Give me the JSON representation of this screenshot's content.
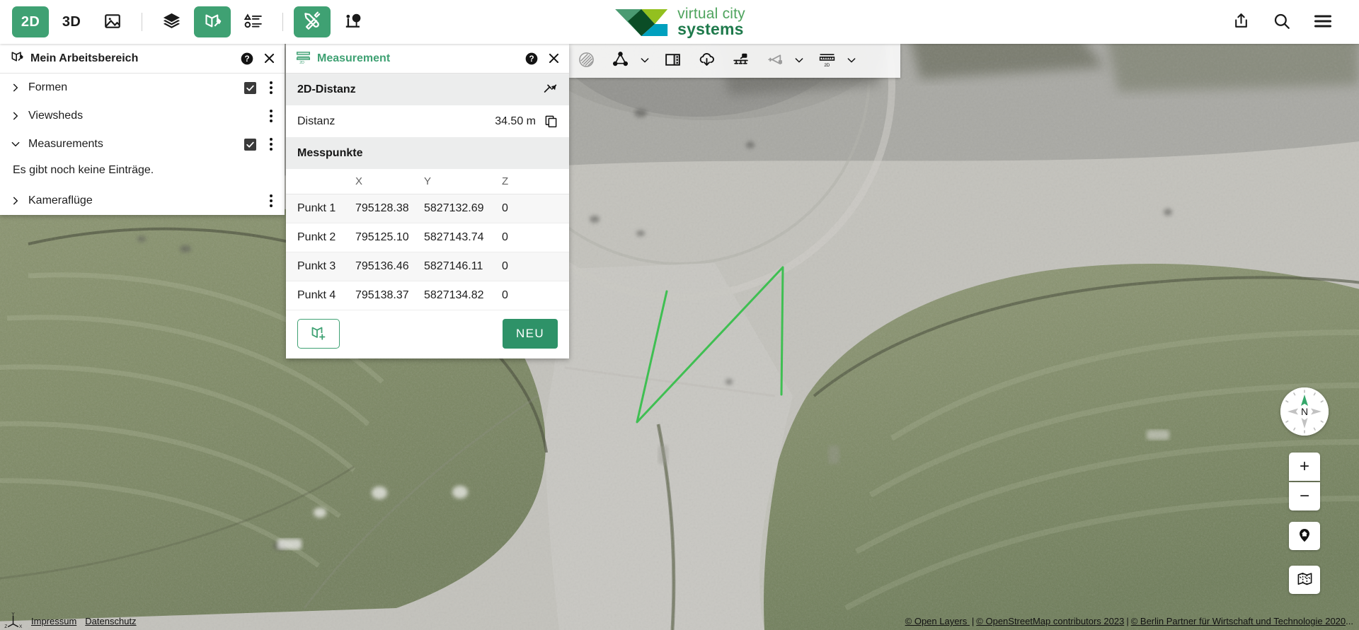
{
  "topbar": {
    "left_items": [
      {
        "name": "2d-mode-button",
        "label": "2D",
        "icon": "text-2d",
        "active": true
      },
      {
        "name": "3d-mode-button",
        "label": "3D",
        "icon": "text-3d",
        "active": false
      },
      {
        "name": "oblique-image-button",
        "label": "",
        "icon": "image-icon",
        "active": false
      },
      {
        "name": "separator-1",
        "label": "",
        "icon": "separator",
        "active": false
      },
      {
        "name": "layers-button",
        "label": "",
        "icon": "layers-icon",
        "active": false
      },
      {
        "name": "workspace-button",
        "label": "",
        "icon": "workspace-icon",
        "active": true
      },
      {
        "name": "legend-button",
        "label": "",
        "icon": "legend-icon",
        "active": false
      },
      {
        "name": "separator-2",
        "label": "",
        "icon": "separator",
        "active": false
      },
      {
        "name": "tools-button",
        "label": "",
        "icon": "tools-icon",
        "active": true
      },
      {
        "name": "planning-button",
        "label": "",
        "icon": "tree-person-icon",
        "active": false
      }
    ],
    "right_items": [
      {
        "name": "share-button",
        "icon": "share-icon"
      },
      {
        "name": "search-button",
        "icon": "search-icon"
      },
      {
        "name": "menu-button",
        "icon": "hamburger-icon"
      }
    ],
    "brand": {
      "line1": "virtual city",
      "line2": "systems"
    }
  },
  "workspace": {
    "title": "Mein Arbeitsbereich",
    "help_icon": "help-icon",
    "close_icon": "close-icon",
    "items": [
      {
        "label": "Formen",
        "expanded": false,
        "checkbox": false,
        "has_menu": true
      },
      {
        "label": "Viewsheds",
        "expanded": false,
        "checkbox": false,
        "has_menu": true
      },
      {
        "label": "Measurements",
        "expanded": true,
        "checkbox": true,
        "has_menu": true
      },
      {
        "label": "Kameraflüge",
        "expanded": false,
        "checkbox": false,
        "has_menu": true
      }
    ],
    "formen_checkbox": true,
    "empty_message": "Es gibt noch keine Einträge."
  },
  "measurement": {
    "title": "Measurement",
    "title_icon": "measure-2d-icon",
    "help_icon": "help-icon",
    "close_icon": "close-icon",
    "section_title": "2D-Distanz",
    "section_icon": "measure-path-icon",
    "distance_label": "Distanz",
    "distance_value": "34.50 m",
    "copy_icon": "copy-icon",
    "points_title": "Messpunkte",
    "columns": [
      "",
      "X",
      "Y",
      "Z"
    ],
    "rows": [
      {
        "name": "Punkt 1",
        "x": "795128.38",
        "y": "5827132.69",
        "z": "0"
      },
      {
        "name": "Punkt 2",
        "x": "795125.10",
        "y": "5827143.74",
        "z": "0"
      },
      {
        "name": "Punkt 3",
        "x": "795136.46",
        "y": "5827146.11",
        "z": "0"
      },
      {
        "name": "Punkt 4",
        "x": "795138.37",
        "y": "5827134.82",
        "z": "0"
      }
    ],
    "add_to_workspace_icon": "workspace-add-icon",
    "new_label": "NEU"
  },
  "map_toolbar": {
    "items": [
      {
        "name": "shadow-tool-button",
        "icon": "sphere-hatch-icon",
        "disabled": true,
        "caret": false
      },
      {
        "name": "create-shape-button",
        "icon": "polygon-points-icon",
        "disabled": false,
        "caret": true
      },
      {
        "name": "split-view-button",
        "icon": "split-view-icon",
        "disabled": false,
        "caret": false
      },
      {
        "name": "export-button",
        "icon": "cloud-download-icon",
        "disabled": false,
        "caret": false
      },
      {
        "name": "viewshed-button",
        "icon": "viewshed-icon",
        "disabled": false,
        "caret": false
      },
      {
        "name": "flight-button",
        "icon": "camera-flight-icon",
        "disabled": true,
        "caret": true
      },
      {
        "name": "measurement-tool-button",
        "icon": "measure-2d-icon",
        "disabled": false,
        "caret": true
      }
    ]
  },
  "map_controls": {
    "compass_label": "N",
    "zoom_in_label": "+",
    "zoom_out_label": "−",
    "home_icon": "home-pin-icon",
    "overview_icon": "overview-map-icon"
  },
  "footer": {
    "axis_icon": "axis-orientation-icon",
    "axis_labels": {
      "y": "Y",
      "z": "Z",
      "x": "X"
    },
    "links": [
      {
        "name": "impressum-link",
        "label": "Impressum"
      },
      {
        "name": "datenschutz-link",
        "label": "Datenschutz"
      }
    ],
    "attribution": [
      {
        "name": "open-layers-link",
        "label": "© Open Layers "
      },
      {
        "name": "osm-link",
        "label": "© OpenStreetMap contributors 2023"
      },
      {
        "name": "berlin-partner-link",
        "label": "© Berlin Partner für Wirtschaft und Technologie 2020"
      }
    ],
    "attribution_sep": "|",
    "attribution_ellipsis": "..."
  },
  "colors": {
    "accent_green": "#3FA173",
    "primary_button": "#2E9268",
    "measurement_line": "#3FBF52",
    "brand_light_green": "#4FA45E",
    "brand_dark_green": "#1F7A4C"
  },
  "map_overlay": {
    "measurement_line_points": "Punkt 1 → Punkt 2 → Punkt 3 → Punkt 4"
  }
}
